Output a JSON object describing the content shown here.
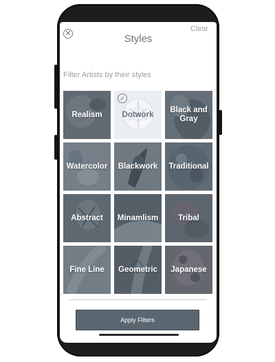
{
  "header": {
    "title": "Styles",
    "clear_label": "Clear",
    "close_icon": "close-icon"
  },
  "filters": {
    "subtitle": "Filter Artists by their styles",
    "styles": [
      {
        "label": "Realism",
        "selected": false
      },
      {
        "label": "Dotwork",
        "selected": true
      },
      {
        "label": "Black and Gray",
        "selected": false
      },
      {
        "label": "Watercolor",
        "selected": false
      },
      {
        "label": "Blackwork",
        "selected": false
      },
      {
        "label": "Traditional",
        "selected": false
      },
      {
        "label": "Abstract",
        "selected": false
      },
      {
        "label": "Minamlism",
        "selected": false
      },
      {
        "label": "Tribal",
        "selected": false
      },
      {
        "label": "Fine Line",
        "selected": false
      },
      {
        "label": "Geometric",
        "selected": false
      },
      {
        "label": "Japanese",
        "selected": false
      }
    ]
  },
  "footer": {
    "apply_label": "Apply Filters"
  },
  "colors": {
    "tile_overlay": "#5d6b78",
    "button": "#5b6770",
    "title_text": "#707478"
  }
}
